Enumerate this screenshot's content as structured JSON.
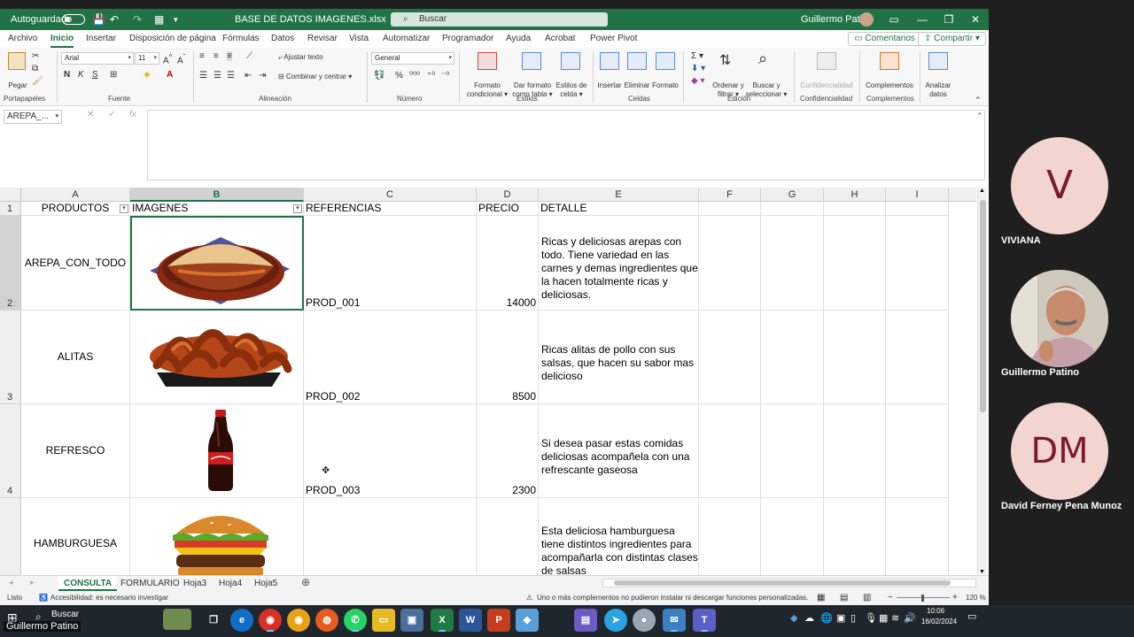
{
  "titlebar": {
    "autosave_label": "Autoguardado",
    "file_name": "BASE DE DATOS IMAGENES.xlsx",
    "search_placeholder": "Buscar",
    "user_name": "Guillermo Patino"
  },
  "menu": {
    "tabs": [
      "Archivo",
      "Inicio",
      "Insertar",
      "Disposición de página",
      "Fórmulas",
      "Datos",
      "Revisar",
      "Vista",
      "Automatizar",
      "Programador",
      "Ayuda",
      "Acrobat",
      "Power Pivot"
    ],
    "comments_label": "Comentarios",
    "share_label": "Compartir"
  },
  "ribbon": {
    "paste_label": "Pegar",
    "clipboard_group": "Portapapeles",
    "font_name": "Arial",
    "font_size": "11",
    "font_group": "Fuente",
    "wrap_text_label": "Ajustar texto",
    "merge_label": "Combinar y centrar",
    "alignment_group": "Alineación",
    "number_format": "General",
    "number_group": "Número",
    "conditional_format_label": [
      "Formato",
      "condicional"
    ],
    "format_table_label": [
      "Dar formato",
      "como tabla"
    ],
    "cell_styles_label": [
      "Estilos de",
      "celda"
    ],
    "styles_group": "Estilos",
    "insert_label": "Insertar",
    "delete_label": "Eliminar",
    "format_label": "Formato",
    "cells_group": "Celdas",
    "sort_label": [
      "Ordenar y",
      "filtrar"
    ],
    "find_label": [
      "Buscar y",
      "seleccionar"
    ],
    "editing_group": "Edición",
    "sensitivity_label": "Confidencialidad",
    "sensitivity_group": "Confidencialidad",
    "addins_label": "Complementos",
    "addins_group": "Complementos",
    "analyze_label": [
      "Analizar",
      "datos"
    ]
  },
  "formula_bar": {
    "name_box": "AREPA_...",
    "formula": ""
  },
  "columns": [
    "A",
    "B",
    "C",
    "D",
    "E",
    "F",
    "G",
    "H",
    "I"
  ],
  "headers": {
    "productos": "PRODUCTOS",
    "imagenes": "IMAGENES",
    "referencias": "REFERENCIAS",
    "precio": "PRECIO",
    "detalle": "DETALLE"
  },
  "rows": [
    {
      "row_num": "2",
      "producto": "AREPA_CON_TODO",
      "image": "arepa-image",
      "referencia": "PROD_001",
      "precio": "14000",
      "detalle": "Ricas y deliciosas arepas con todo. Tiene variedad en las carnes y demas ingredientes que la hacen totalmente ricas y deliciosas."
    },
    {
      "row_num": "3",
      "producto": "ALITAS",
      "image": "wings-image",
      "referencia": "PROD_002",
      "precio": "8500",
      "detalle": "Ricas alitas de pollo con sus salsas, que hacen su sabor mas delicioso"
    },
    {
      "row_num": "4",
      "producto": "REFRESCO",
      "image": "soda-image",
      "referencia": "PROD_003",
      "precio": "2300",
      "detalle": "Si desea pasar estas comidas deliciosas acompañela con una refrescante gaseosa"
    },
    {
      "row_num": "",
      "producto": "HAMBURGUESA",
      "image": "burger-image",
      "referencia": "",
      "precio": "",
      "detalle": "Esta deliciosa hamburguesa tiene distintos ingredientes para acompañarla con distintas clases de salsas"
    }
  ],
  "row_header_1": "1",
  "sheet_tabs": [
    "CONSULTA",
    "FORMULARIO",
    "Hoja3",
    "Hoja4",
    "Hoja5"
  ],
  "status": {
    "ready": "Listo",
    "accessibility": "Accesibilidad: es necesario investigar",
    "addins_message": "Uno o más complementos no pudieron instalar ni descargar funciones personalizadas.",
    "zoom": "120 %"
  },
  "taskbar": {
    "search_label": "Buscar",
    "time": "10:06",
    "date": "16/02/2024",
    "presenter_label": "Guillermo Patino"
  },
  "participants": [
    {
      "initials": "V",
      "name": "VIVIANA"
    },
    {
      "initials": "",
      "name": "Guillermo Patino"
    },
    {
      "initials": "DM",
      "name": "David Ferney Pena Munoz"
    }
  ],
  "colors": {
    "excel_green": "#217346",
    "avatar_bg": "#f3d5d0",
    "avatar_text": "#7b1c2a"
  }
}
